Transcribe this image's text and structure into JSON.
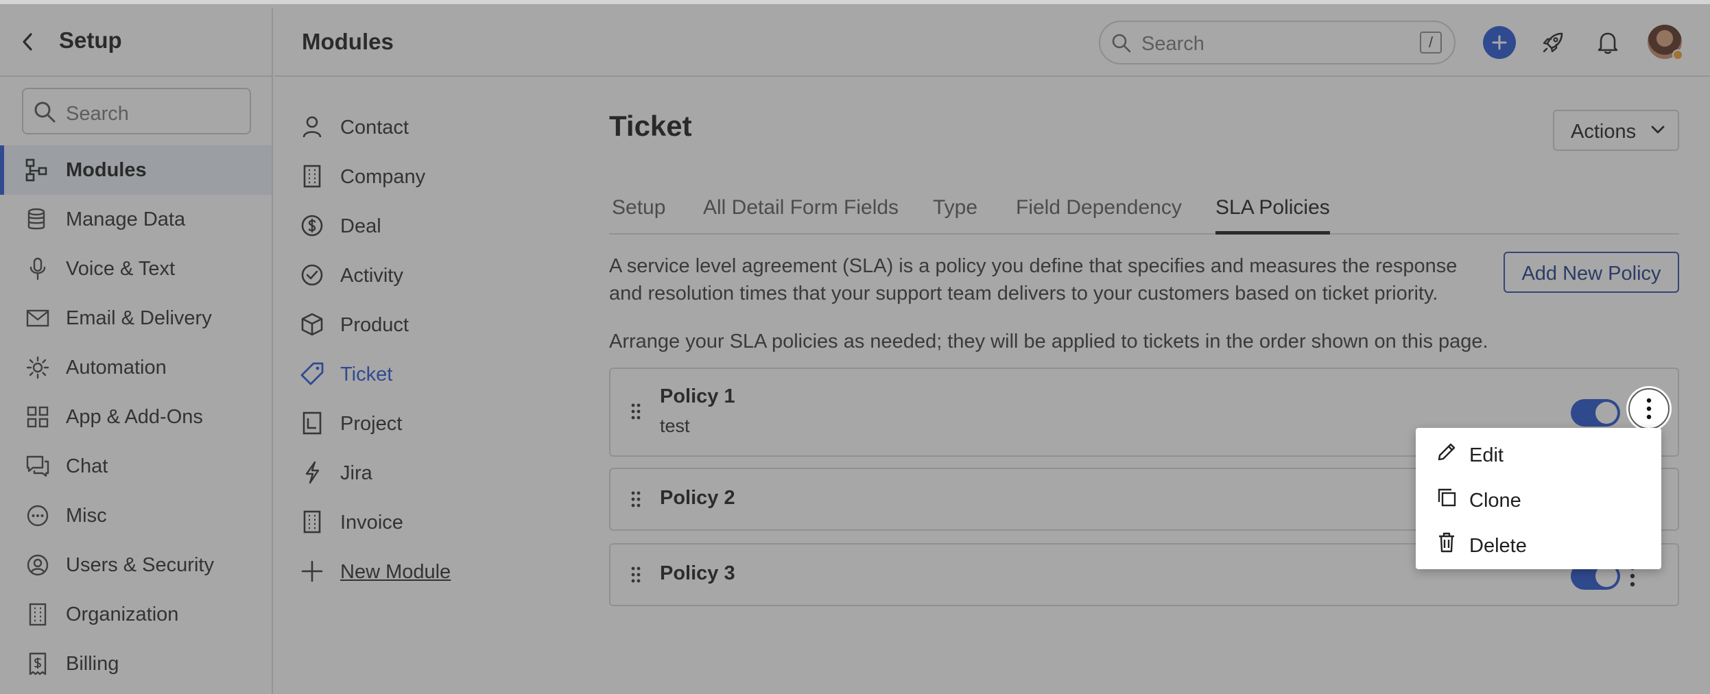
{
  "sidebar": {
    "title": "Setup",
    "search_placeholder": "Search",
    "items": [
      {
        "label": "Modules",
        "icon": "modules-icon",
        "active": true
      },
      {
        "label": "Manage Data",
        "icon": "database-icon"
      },
      {
        "label": "Voice & Text",
        "icon": "microphone-icon"
      },
      {
        "label": "Email & Delivery",
        "icon": "mail-icon"
      },
      {
        "label": "Automation",
        "icon": "automation-gear-icon"
      },
      {
        "label": "App & Add-Ons",
        "icon": "apps-grid-icon"
      },
      {
        "label": "Chat",
        "icon": "chat-icon"
      },
      {
        "label": "Misc",
        "icon": "more-circle-icon"
      },
      {
        "label": "Users & Security",
        "icon": "user-circle-icon"
      },
      {
        "label": "Organization",
        "icon": "building-icon"
      },
      {
        "label": "Billing",
        "icon": "billing-icon"
      }
    ]
  },
  "topbar": {
    "title": "Modules",
    "search_placeholder": "Search",
    "search_shortcut": "/"
  },
  "modules": [
    {
      "label": "Contact",
      "icon": "person-icon"
    },
    {
      "label": "Company",
      "icon": "building-icon"
    },
    {
      "label": "Deal",
      "icon": "dollar-circle-icon"
    },
    {
      "label": "Activity",
      "icon": "check-circle-icon"
    },
    {
      "label": "Product",
      "icon": "box-icon"
    },
    {
      "label": "Ticket",
      "icon": "ticket-tag-icon",
      "active": true
    },
    {
      "label": "Project",
      "icon": "project-icon"
    },
    {
      "label": "Jira",
      "icon": "lightning-icon"
    },
    {
      "label": "Invoice",
      "icon": "invoice-icon"
    },
    {
      "label": "New Module",
      "icon": "plus-icon",
      "link": true
    }
  ],
  "main": {
    "title": "Ticket",
    "actions_label": "Actions",
    "tabs": [
      {
        "label": "Setup"
      },
      {
        "label": "All Detail Form Fields"
      },
      {
        "label": "Type"
      },
      {
        "label": "Field Dependency"
      },
      {
        "label": "SLA Policies",
        "active": true
      }
    ],
    "description_line1": "A service level agreement (SLA) is a policy you define that specifies and measures the response",
    "description_line2": "and resolution times that your support team delivers to your customers based on ticket priority.",
    "add_policy_label": "Add New Policy",
    "arrange_text": "Arrange your SLA policies as needed; they will be applied to tickets in the order shown on this page.",
    "policies": [
      {
        "name": "Policy 1",
        "description": "test",
        "enabled": true
      },
      {
        "name": "Policy 2",
        "description": "",
        "enabled": true
      },
      {
        "name": "Policy 3",
        "description": "",
        "enabled": true
      }
    ]
  },
  "context_menu": {
    "items": [
      {
        "label": "Edit",
        "icon": "pencil-icon"
      },
      {
        "label": "Clone",
        "icon": "copy-icon"
      },
      {
        "label": "Delete",
        "icon": "trash-icon"
      }
    ]
  },
  "colors": {
    "accent": "#2a57d6",
    "toggle_on": "#2554d0",
    "overlay": "rgba(60,60,60,0.45)"
  }
}
